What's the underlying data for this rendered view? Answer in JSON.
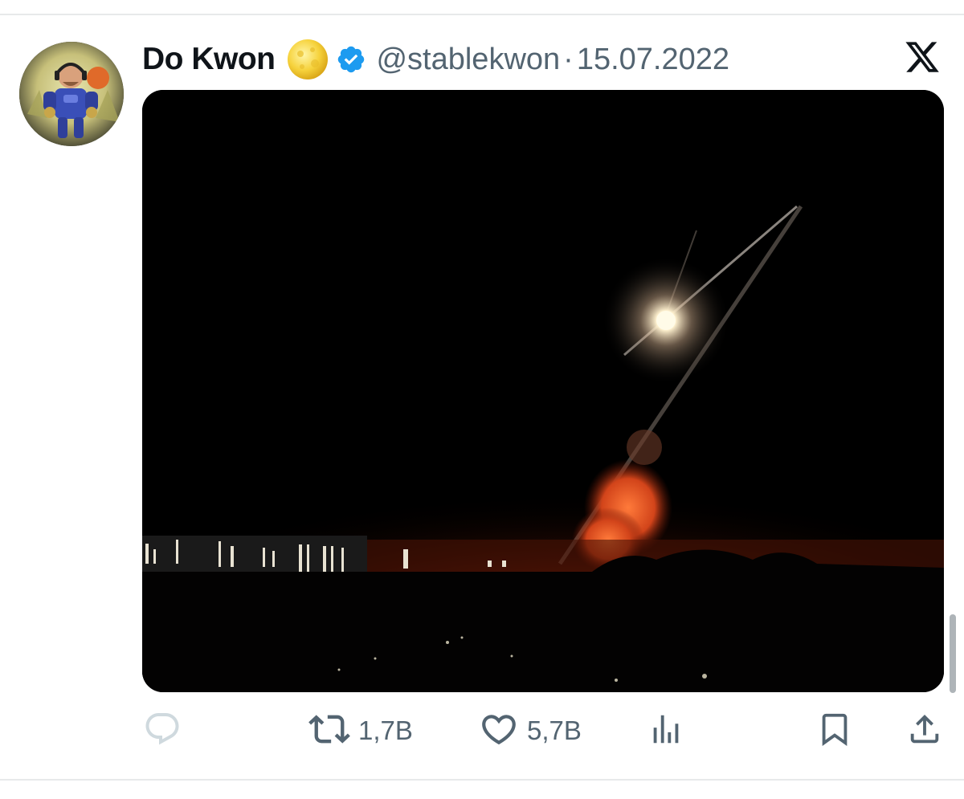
{
  "tweet": {
    "author": {
      "display_name": "Do Kwon",
      "handle": "@stablekwon",
      "avatar_icon": "avatar-cartoon-robot",
      "emoji_icon": "full-moon-icon",
      "verified_icon": "verified-badge-icon"
    },
    "separator": "·",
    "date": "15.07.2022",
    "platform_icon": "x-logo-icon",
    "media_icon": "night-explosion-photo",
    "actions": {
      "reply_icon": "reply-icon",
      "retweet_icon": "retweet-icon",
      "retweet_count": "1,7B",
      "like_icon": "heart-icon",
      "like_count": "5,7B",
      "views_icon": "analytics-icon",
      "bookmark_icon": "bookmark-icon",
      "share_icon": "share-icon"
    }
  },
  "colors": {
    "text_primary": "#0f1419",
    "text_secondary": "#536471",
    "verified_blue": "#1d9bf0",
    "divider": "#e7e9ea"
  }
}
